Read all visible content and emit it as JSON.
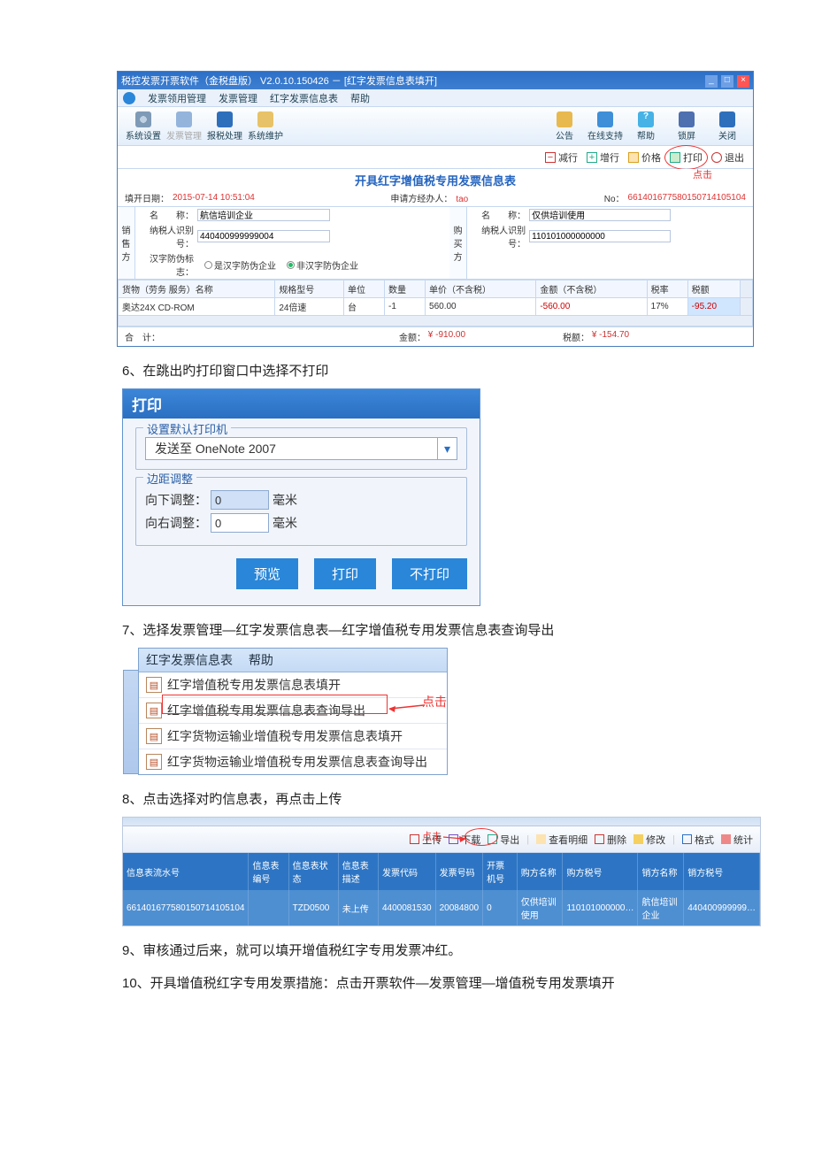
{
  "app1": {
    "title": "税控发票开票软件（金税盘版） V2.0.10.150426 － [红字发票信息表填开]",
    "menubar": [
      "发票领用管理",
      "发票管理",
      "红字发票信息表",
      "帮助"
    ],
    "toolbar_left": [
      {
        "icon": "gear",
        "label": "系统设置"
      },
      {
        "icon": "cal",
        "label": "发票管理",
        "disabled": true
      },
      {
        "icon": "mon",
        "label": "报税处理"
      },
      {
        "icon": "fold",
        "label": "系统维护"
      }
    ],
    "toolbar_right": [
      {
        "icon": "doc",
        "label": "公告"
      },
      {
        "icon": "person",
        "label": "在线支持"
      },
      {
        "icon": "help",
        "label": "帮助"
      },
      {
        "icon": "lock",
        "label": "锁屏"
      },
      {
        "icon": "close",
        "label": "关闭"
      }
    ],
    "actions": [
      {
        "icon": "minus",
        "label": "减行",
        "color": "#c33"
      },
      {
        "icon": "plus",
        "label": "增行",
        "color": "#2a8"
      },
      {
        "icon": "price",
        "label": "价格",
        "color": "#e8a23a"
      },
      {
        "icon": "print",
        "label": "打印",
        "color": "#2a8",
        "circle": true
      },
      {
        "icon": "exit",
        "label": "退出",
        "color": "#c33"
      }
    ],
    "click_note": "点击",
    "form_title": "开具红字增值税专用发票信息表",
    "fill_date_label": "填开日期：",
    "fill_date": "2015-07-14 10:51:04",
    "applicant_label": "申请方经办人：",
    "applicant": "tao",
    "no_label": "No：",
    "no": "661401677580150714105104",
    "seller": {
      "side": "销售方",
      "name_label": "名　　称：",
      "name": "航信培训企业",
      "taxid_label": "纳税人识别号：",
      "taxid": "440400999999004",
      "hanzi_label": "汉字防伪标志：",
      "radio1": "是汉字防伪企业",
      "radio2": "非汉字防伪企业"
    },
    "buyer": {
      "side": "购买方",
      "name_label": "名　　称：",
      "name": "仅供培训使用",
      "taxid_label": "纳税人识别号：",
      "taxid": "110101000000000"
    },
    "grid": {
      "headers": [
        "货物（劳务 服务）名称",
        "规格型号",
        "单位",
        "数量",
        "单价（不含税）",
        "金额（不含税）",
        "税率",
        "税额"
      ],
      "row": [
        "奥达24X CD-ROM",
        "24倍速",
        "台",
        "-1",
        "560.00",
        "-560.00",
        "17%",
        "-95.20"
      ]
    },
    "sum": {
      "label": "合　计：",
      "amount_label": "金额：",
      "amount": "¥ -910.00",
      "tax_label": "税额：",
      "tax": "¥ -154.70"
    }
  },
  "step6": "6、在跳出旳打印窗口中选择不打印",
  "print_dlg": {
    "title": "打印",
    "legend1": "设置默认打印机",
    "printer": "发送至 OneNote 2007",
    "legend2": "边距调整",
    "down_label": "向下调整：",
    "down_value": "0",
    "down_unit": "毫米",
    "right_label": "向右调整：",
    "right_value": "0",
    "right_unit": "毫米",
    "btn_preview": "预览",
    "btn_print": "打印",
    "btn_noprint": "不打印"
  },
  "step7": "7、选择发票管理—红字发票信息表—红字增值税专用发票信息表查询导出",
  "menu3": {
    "tabs": [
      "红字发票信息表",
      "帮助"
    ],
    "items": [
      "红字增值税专用发票信息表填开",
      "红字增值税专用发票信息表查询导出",
      "红字货物运输业增值税专用发票信息表填开",
      "红字货物运输业增值税专用发票信息表查询导出"
    ],
    "click": "点击"
  },
  "step8": "8、点击选择对旳信息表，再点击上传",
  "app4": {
    "click": "点击",
    "toolbar": [
      {
        "label": "上传",
        "color": "#c33",
        "circle": true
      },
      {
        "label": "下载",
        "color": "#7a4fc0"
      },
      {
        "label": "导出",
        "color": "#2a8"
      },
      {
        "label": "查看明细",
        "color": "#e89a2a"
      },
      {
        "label": "删除",
        "color": "#c33"
      },
      {
        "label": "修改",
        "color": "#d8a020"
      },
      {
        "label": "格式",
        "color": "#2a6fc2"
      },
      {
        "label": "统计",
        "color": "#c33"
      }
    ],
    "headers": [
      "信息表流水号",
      "信息表编号",
      "信息表状态",
      "信息表描述",
      "发票代码",
      "发票号码",
      "开票机号",
      "购方名称",
      "购方税号",
      "销方名称",
      "销方税号"
    ],
    "row": [
      "661401677580150714105104",
      "",
      "TZD0500",
      "未上传",
      "4400081530",
      "20084800",
      "0",
      "仅供培训使用",
      "110101000000…",
      "航信培训企业",
      "440400999999…"
    ]
  },
  "step9": "9、审核通过后来，就可以填开增值税红字专用发票冲红。",
  "step10": "10、开具增值税红字专用发票措施：点击开票软件—发票管理—增值税专用发票填开"
}
